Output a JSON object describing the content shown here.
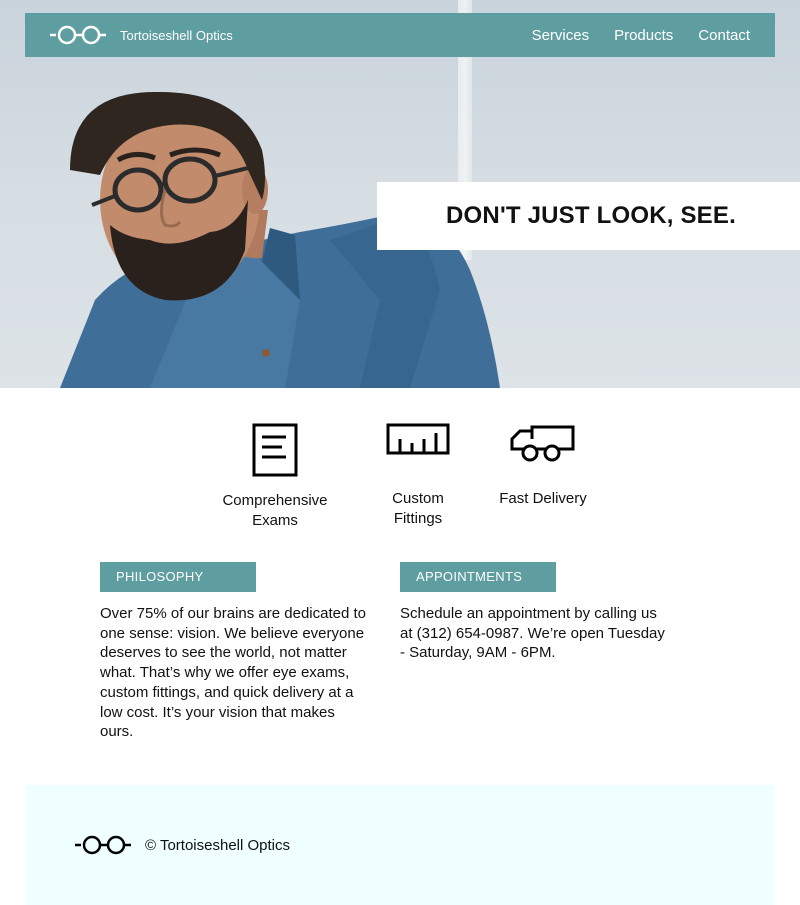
{
  "brand": {
    "name": "Tortoiseshell Optics",
    "logo_icon": "glasses-icon"
  },
  "nav": {
    "items": [
      {
        "label": "Services"
      },
      {
        "label": "Products"
      },
      {
        "label": "Contact"
      }
    ]
  },
  "hero": {
    "tagline": "DON'T JUST LOOK, SEE."
  },
  "features": [
    {
      "label": "Comprehensive Exams",
      "icon": "document-icon"
    },
    {
      "label": "Custom Fittings",
      "icon": "ruler-icon"
    },
    {
      "label": "Fast Delivery",
      "icon": "truck-icon"
    }
  ],
  "philosophy": {
    "heading": "PHILOSOPHY",
    "text": "Over 75% of our brains are dedicated to one sense: vision. We believe everyone deserves to see the world, not matter what. That’s why we offer eye exams, custom fittings, and quick delivery at a low cost. It’s your vision that makes ours."
  },
  "appointments": {
    "heading": "APPOINTMENTS",
    "text": "Schedule an appointment by calling us at (312) 654-0987. We’re open Tuesday - Saturday, 9AM - 6PM."
  },
  "footer": {
    "copyright": "© Tortoiseshell Optics"
  },
  "colors": {
    "accent": "#5f9ea0",
    "footer_bg": "#f0ffff",
    "text": "#111111"
  }
}
